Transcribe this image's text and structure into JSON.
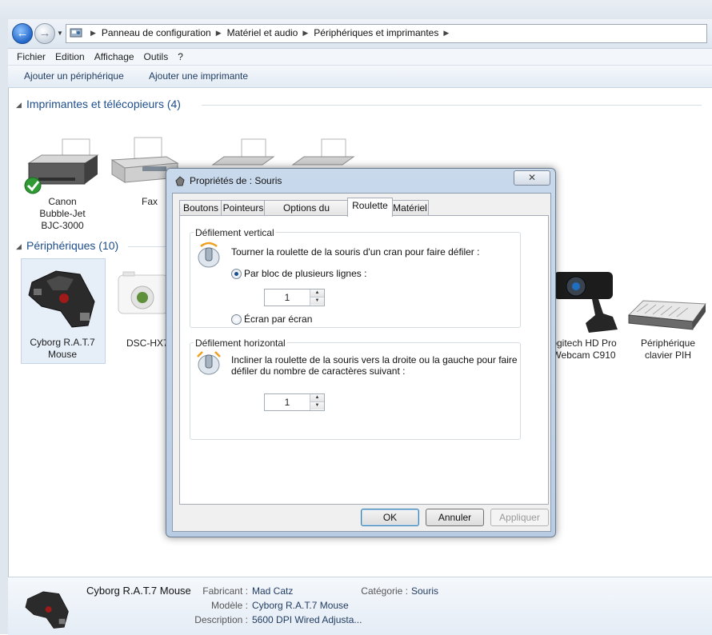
{
  "address": {
    "crumbs": [
      "Panneau de configuration",
      "Matériel et audio",
      "Périphériques et imprimantes"
    ]
  },
  "menu": [
    "Fichier",
    "Edition",
    "Affichage",
    "Outils",
    "?"
  ],
  "commands": {
    "add_device": "Ajouter un périphérique",
    "add_printer": "Ajouter une imprimante"
  },
  "printers_group": {
    "title": "Imprimantes et télécopieurs (4)",
    "items": [
      {
        "label1": "Canon",
        "label2": "Bubble-Jet",
        "label3": "BJC-3000"
      },
      {
        "label1": "Fax"
      }
    ]
  },
  "devices_group": {
    "title": "Périphériques (10)",
    "items": [
      {
        "label1": "Cyborg R.A.T.7",
        "label2": "Mouse"
      },
      {
        "label1": "DSC-HX7"
      },
      {
        "label1": "ogitech HD Pro",
        "label2": "Webcam C910"
      },
      {
        "label1": "Périphérique",
        "label2": "clavier PIH"
      }
    ]
  },
  "details": {
    "name": "Cyborg R.A.T.7 Mouse",
    "manufacturer_key": "Fabricant :",
    "manufacturer": "Mad Catz",
    "model_key": "Modèle :",
    "model": "Cyborg R.A.T.7 Mouse",
    "description_key": "Description :",
    "description": "5600 DPI Wired Adjusta...",
    "category_key": "Catégorie :",
    "category": "Souris"
  },
  "dialog": {
    "title": "Propriétés de : Souris",
    "tabs": [
      "Boutons",
      "Pointeurs",
      "Options du pointeur",
      "Roulette",
      "Matériel"
    ],
    "vertical": {
      "legend": "Défilement vertical",
      "instruction": "Tourner la roulette de la souris d'un cran pour faire défiler :",
      "option1": "Par bloc de plusieurs lignes :",
      "lines_value": "1",
      "option2": "Écran par écran"
    },
    "horizontal": {
      "legend": "Défilement horizontal",
      "instruction_line1": "Incliner la roulette de la souris vers la droite ou la gauche pour faire",
      "instruction_line2": "défiler du nombre de caractères suivant :",
      "chars_value": "1"
    },
    "ok": "OK",
    "cancel": "Annuler",
    "apply": "Appliquer"
  }
}
